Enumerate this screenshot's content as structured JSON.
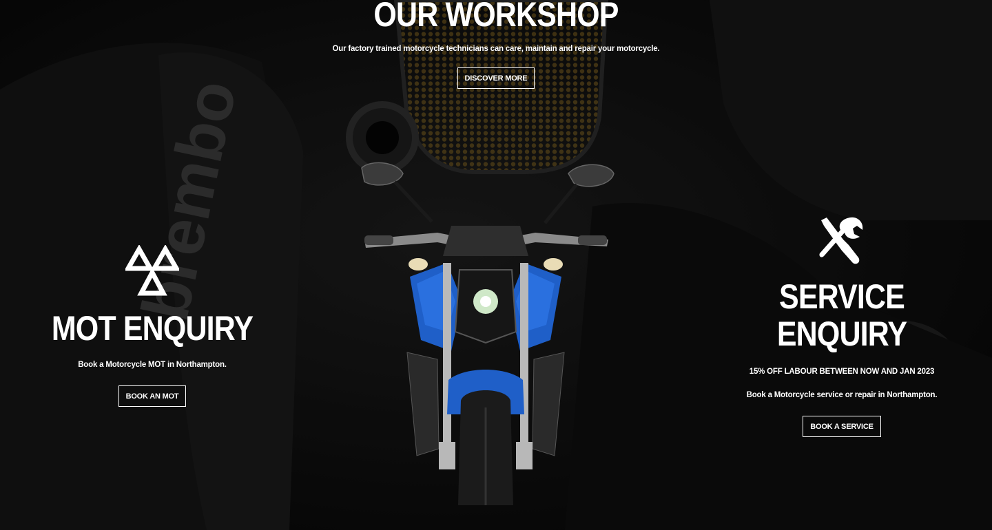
{
  "workshop": {
    "title": "OUR WORKSHOP",
    "subtitle": "Our factory trained motorcycle technicians can care, maintain and repair your motorcycle.",
    "button_label": "DISCOVER MORE"
  },
  "mot": {
    "icon": "mot-triangles-icon",
    "title": "MOT ENQUIRY",
    "subtitle": "Book a Motorcycle MOT in Northampton.",
    "button_label": "BOOK AN MOT"
  },
  "service": {
    "icon": "wrench-screwdriver-icon",
    "title_line1": "SERVICE",
    "title_line2": "ENQUIRY",
    "promo": "15% OFF LABOUR BETWEEN NOW AND JAN 2023",
    "subtitle": "Book a Motorcycle service or repair in Northampton.",
    "button_label": "BOOK A SERVICE"
  },
  "colors": {
    "background": "#050505",
    "text": "#ffffff",
    "bike_blue": "#1f5fc8"
  }
}
